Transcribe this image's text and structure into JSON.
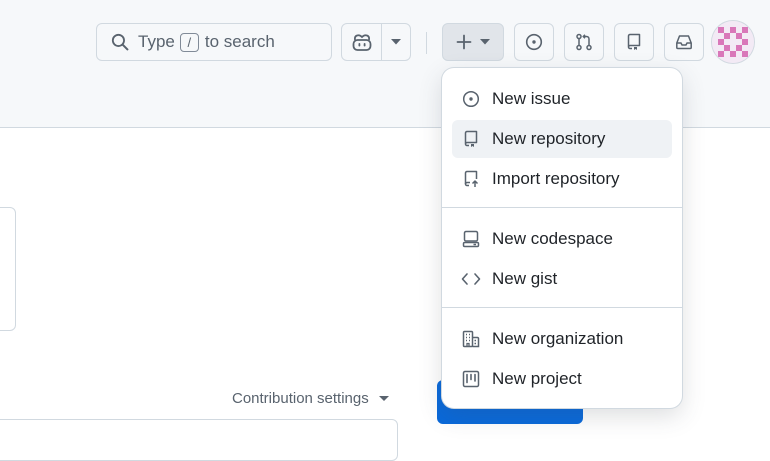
{
  "search": {
    "label_before": "Type",
    "shortcut_key": "/",
    "label_after": "to search",
    "icon": "search-icon"
  },
  "toolbar": {
    "copilot_icon": "copilot-icon",
    "create_icon": "plus-icon",
    "issues_icon": "issue-opened-icon",
    "pulls_icon": "git-pull-request-icon",
    "repos_icon": "repo-icon",
    "inbox_icon": "inbox-icon"
  },
  "create_menu": {
    "groups": [
      [
        {
          "label": "New issue",
          "icon": "issue-opened-icon"
        },
        {
          "label": "New repository",
          "icon": "repo-icon"
        },
        {
          "label": "Import repository",
          "icon": "repo-push-icon"
        }
      ],
      [
        {
          "label": "New codespace",
          "icon": "codespaces-icon"
        },
        {
          "label": "New gist",
          "icon": "code-icon"
        }
      ],
      [
        {
          "label": "New organization",
          "icon": "organization-icon"
        },
        {
          "label": "New project",
          "icon": "project-icon"
        }
      ]
    ]
  },
  "page": {
    "contribution_settings": "Contribution settings"
  },
  "colors": {
    "header_bg": "#f6f8fa",
    "border": "#d1d9e0",
    "text": "#1f2328",
    "muted": "#59636e",
    "primary_button": "#0969da",
    "menu_hover": "#eff2f5"
  }
}
